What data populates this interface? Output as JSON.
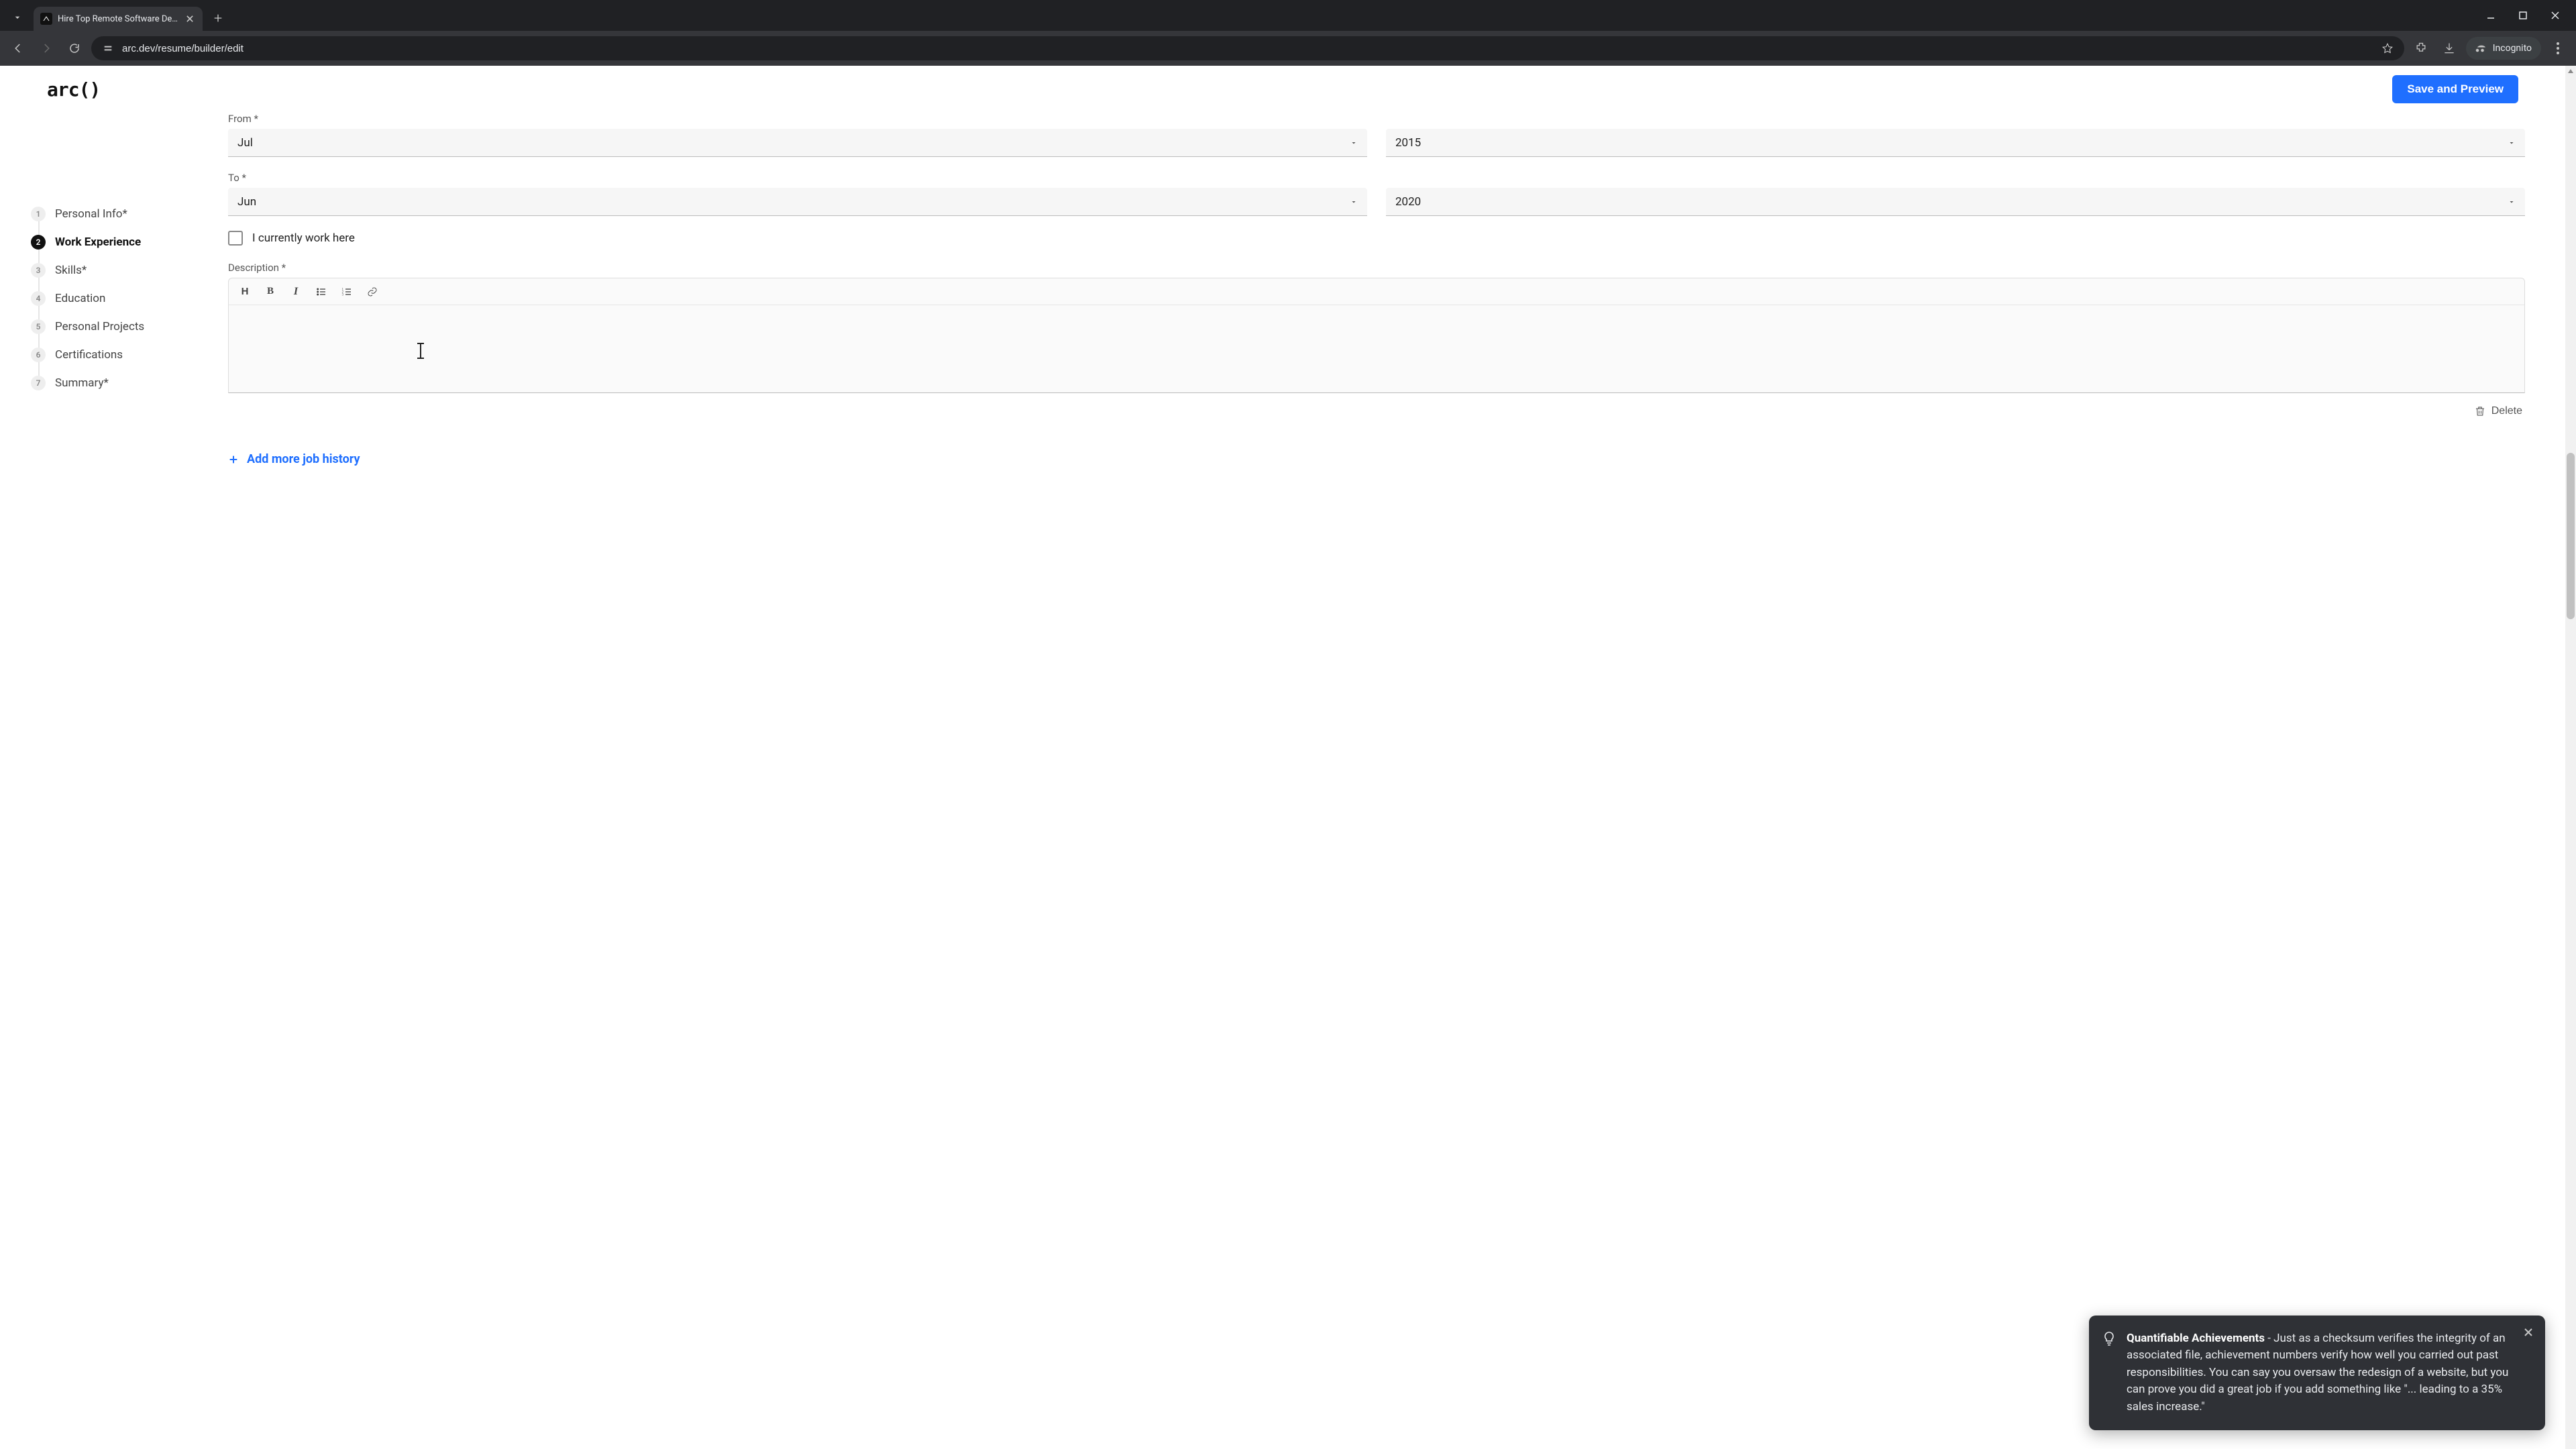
{
  "browser": {
    "tab_title": "Hire Top Remote Software Deve",
    "url": "arc.dev/resume/builder/edit",
    "incognito_label": "Incognito"
  },
  "header": {
    "logo_text": "arc()",
    "save_button": "Save and Preview"
  },
  "sidebar": {
    "steps": [
      {
        "num": "1",
        "label": "Personal Info*"
      },
      {
        "num": "2",
        "label": "Work Experience"
      },
      {
        "num": "3",
        "label": "Skills*"
      },
      {
        "num": "4",
        "label": "Education"
      },
      {
        "num": "5",
        "label": "Personal Projects"
      },
      {
        "num": "6",
        "label": "Certifications"
      },
      {
        "num": "7",
        "label": "Summary*"
      }
    ]
  },
  "form": {
    "from_label": "From *",
    "from_month": "Jul",
    "from_year": "2015",
    "to_label": "To *",
    "to_month": "Jun",
    "to_year": "2020",
    "currently_work_label": "I currently work here",
    "description_label": "Description *",
    "delete_label": "Delete",
    "add_more_label": "Add more job history"
  },
  "tip": {
    "title": "Quantifiable Achievements",
    "body": " - Just as a checksum verifies the integrity of an associated file, achievement numbers verify how well you carried out past responsibilities. You can say you oversaw the redesign of a website, but you can prove you did a great job if you add something like \"... leading to a 35% sales increase.\""
  }
}
